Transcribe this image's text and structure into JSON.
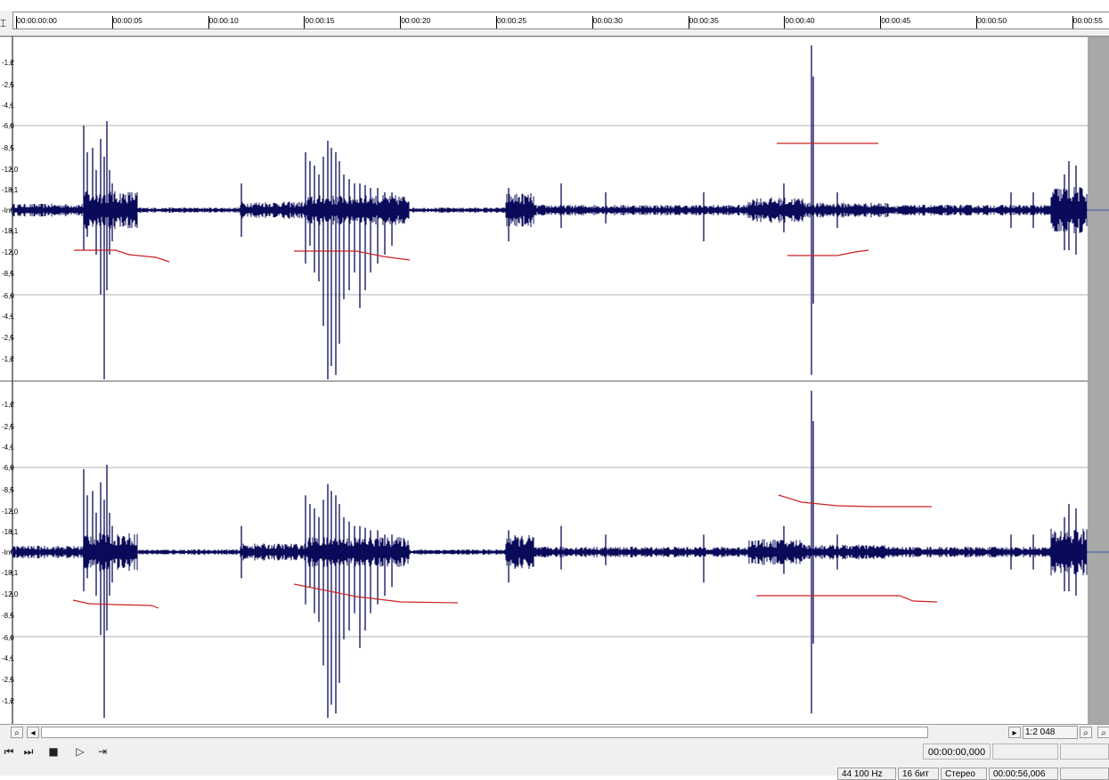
{
  "ruler": {
    "ticks": [
      "00:00:00:00",
      "00:00:05",
      "00:00:10",
      "00:00:15",
      "00:00:20",
      "00:00:25",
      "00:00:30",
      "00:00:35",
      "00:00:40",
      "00:00:45",
      "00:00:50",
      "00:00:55"
    ]
  },
  "scale_labels": [
    "-1,2",
    "-2,5",
    "-4,1",
    "-6,0",
    "-8,5",
    "-12,0",
    "-18,1",
    "-Inf.",
    "-18,1",
    "-12,0",
    "-8,5",
    "-6,0",
    "-4,1",
    "-2,5",
    "-1,2"
  ],
  "colors": {
    "wave": "#0a0a5a",
    "annotation": "#cc2222",
    "grid": "#b0b0b0",
    "scrollbar_right": "#a8a8a8"
  },
  "icons": {
    "cursor": "i-beam-icon",
    "zoom_in": "magnifier-icon",
    "left": "arrow-left-icon",
    "right": "arrow-right-icon",
    "skip_back": "skip-back-icon",
    "skip_fwd": "skip-forward-icon",
    "stop": "stop-icon",
    "play": "play-icon",
    "loop": "loop-icon"
  },
  "scrollbar": {
    "zoom_ratio": "1:2 048"
  },
  "transport": {
    "time": "00:00:00,000"
  },
  "status": {
    "sample_rate": "44 100 Hz",
    "bit_depth": "16 бит",
    "channels": "Стерео",
    "duration": "00:00:56,006"
  }
}
